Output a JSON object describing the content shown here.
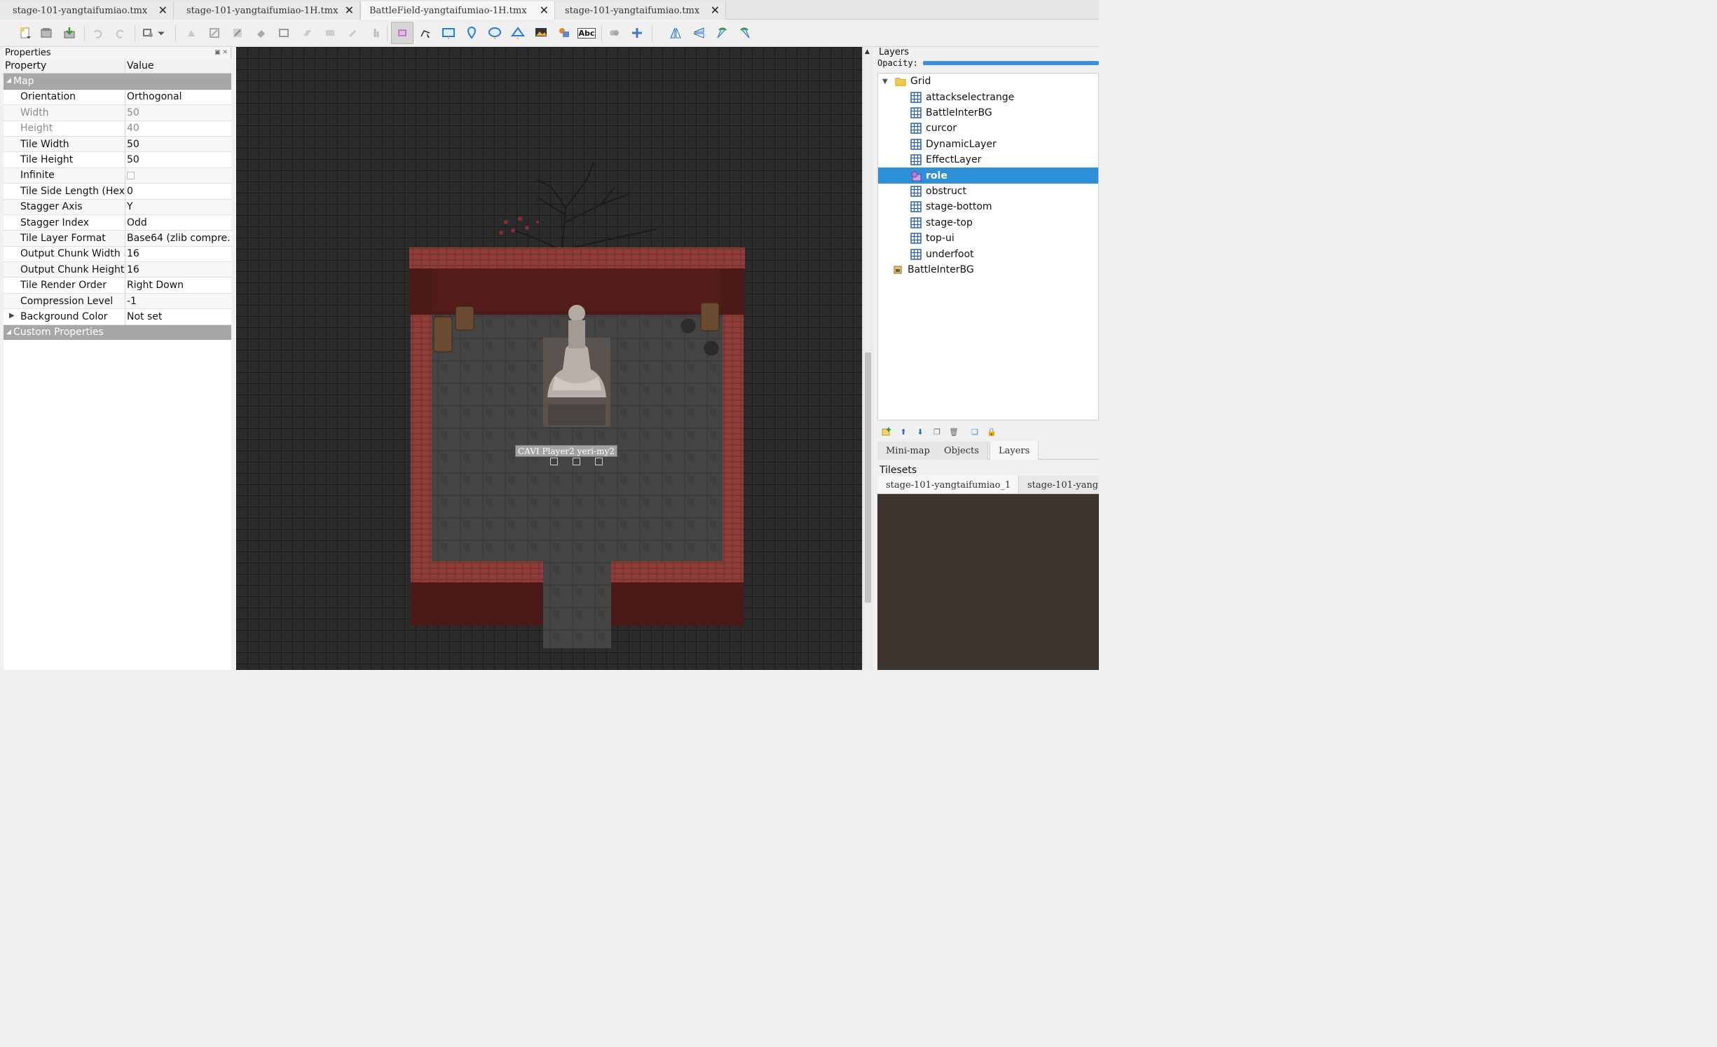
{
  "tabs": [
    {
      "label": "stage-101-yangtaifumiao.tmx",
      "active": false
    },
    {
      "label": "stage-101-yangtaifumiao-1H.tmx",
      "active": false
    },
    {
      "label": "BattleField-yangtaifumiao-1H.tmx",
      "active": true
    },
    {
      "label": "stage-101-yangtaifumiao.tmx",
      "active": false
    }
  ],
  "close_glyph": "✕",
  "toolbar": {
    "tools": [
      "new-map-icon",
      "open-icon",
      "save-icon",
      "undo-icon",
      "redo-icon",
      "stamp-brush-icon",
      "dropdown-icon",
      "terrain-brush-icon",
      "bucket-fill-icon",
      "shape-fill-icon",
      "eraser-icon",
      "rect-select-icon",
      "magic-wand-icon",
      "select-same-icon",
      "tile-picker-icon",
      "object-select-icon",
      "edit-polygons-icon",
      "insert-rectangle-icon",
      "insert-point-icon",
      "insert-ellipse-icon",
      "insert-polygon-icon",
      "insert-tile-icon",
      "insert-template-icon",
      "insert-text-icon",
      "random-mode-icon",
      "wang-mode-icon",
      "flip-horizontal-icon",
      "flip-vertical-icon",
      "rotate-left-icon",
      "rotate-right-icon"
    ],
    "text_tool_label": "Abc"
  },
  "properties": {
    "title": "Properties",
    "col_property": "Property",
    "col_value": "Value",
    "group_map": "Map",
    "rows": [
      {
        "name": "Orientation",
        "value": "Orthogonal",
        "dim": false
      },
      {
        "name": "Width",
        "value": "50",
        "dim": true
      },
      {
        "name": "Height",
        "value": "40",
        "dim": true
      },
      {
        "name": "Tile Width",
        "value": "50",
        "dim": false
      },
      {
        "name": "Tile Height",
        "value": "50",
        "dim": false
      },
      {
        "name": "Infinite",
        "value": "",
        "dim": false,
        "checkbox": true
      },
      {
        "name": "Tile Side Length (Hex)",
        "value": "0",
        "dim": false
      },
      {
        "name": "Stagger Axis",
        "value": "Y",
        "dim": false
      },
      {
        "name": "Stagger Index",
        "value": "Odd",
        "dim": false
      },
      {
        "name": "Tile Layer Format",
        "value": "Base64 (zlib compre...",
        "dim": false
      },
      {
        "name": "Output Chunk Width",
        "value": "16",
        "dim": false
      },
      {
        "name": "Output Chunk Height",
        "value": "16",
        "dim": false
      },
      {
        "name": "Tile Render Order",
        "value": "Right Down",
        "dim": false
      },
      {
        "name": "Compression Level",
        "value": "-1",
        "dim": false
      },
      {
        "name": "Background Color",
        "value": "Not set",
        "dim": false,
        "expandable": true
      }
    ],
    "group_custom": "Custom Properties"
  },
  "canvas": {
    "object_label": "CAVI Player2 yeri-my2"
  },
  "layers": {
    "title": "Layers",
    "opacity_label": "Opacity:",
    "opacity": 1.0,
    "group_name": "Grid",
    "items": [
      {
        "name": "attackselectrange",
        "type": "tile",
        "selected": false
      },
      {
        "name": "BattleInterBG",
        "type": "tile",
        "selected": false
      },
      {
        "name": "curcor",
        "type": "tile",
        "selected": false
      },
      {
        "name": "DynamicLayer",
        "type": "tile",
        "selected": false
      },
      {
        "name": "EffectLayer",
        "type": "tile",
        "selected": false
      },
      {
        "name": "role",
        "type": "object",
        "selected": true
      },
      {
        "name": "obstruct",
        "type": "tile",
        "selected": false
      },
      {
        "name": "stage-bottom",
        "type": "tile",
        "selected": false
      },
      {
        "name": "stage-top",
        "type": "tile",
        "selected": false
      },
      {
        "name": "top-ui",
        "type": "tile",
        "selected": false
      },
      {
        "name": "underfoot",
        "type": "tile",
        "selected": false
      }
    ],
    "image_layer": "BattleInterBG"
  },
  "dock_tabs": [
    "Mini-map",
    "Objects",
    "Layers"
  ],
  "dock_active": "Layers",
  "tilesets": {
    "title": "Tilesets",
    "tabs": [
      "stage-101-yangtaifumiao_1",
      "stage-101-yang"
    ]
  },
  "colors": {
    "selection": "#2f8fd7",
    "canvas_bg": "#2b2b2b",
    "wall_red": "#8a3a34",
    "wall_dark": "#4a1a18",
    "floor": "#3e3e3e",
    "tileset_bg": "#3d342e"
  }
}
